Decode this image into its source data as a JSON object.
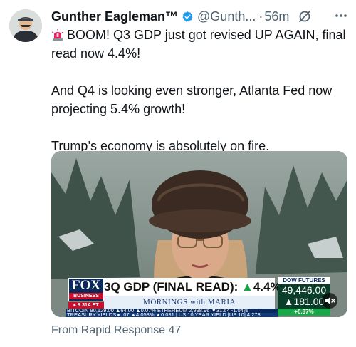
{
  "author": {
    "display_name": "Gunther Eagleman™",
    "handle": "@Gunth...",
    "time_separator": "·",
    "time": "56m",
    "avatar_icon": "profile-photo",
    "verified_icon": "verified-badge-icon"
  },
  "tweet": {
    "line1": "BOOM! Q3 GDP just got revised UP AGAIN, final read now 4.4%!",
    "line2": "And Q4 is looking even stronger, Atlanta Fed now projecting 5.4% growth!",
    "line3": "Trump’s economy is absolutely on fire.",
    "emoji_icon": "police-light-emoji"
  },
  "media": {
    "fox_logo": "FOX",
    "fox_sub": "BUSINESS",
    "time_tag": "▸ 8:31A ET",
    "headline_prefix": "3Q GDP (FINAL READ): ",
    "headline_arrow": "▲",
    "headline_value": "4.4%",
    "show_name": "MORNINGS with MARIA",
    "dow_title": "DOW FUTURES",
    "dow_value": "49,446.00",
    "dow_change": "▲181.00",
    "dow_pct": "+0.37%",
    "ticker_row1": "BITCOIN  90,129.00 ▲64.00 ▲0.07%  ETHEREUM  2,998.96 ▼31.64 -1.04%",
    "ticker_row2": "TREASURY YIELDS ▸ .07 ▲4.058% ▲0.031 | US 10 YEAR YIELD [US.10] 4.273",
    "mute_icon": "speaker-muted-icon"
  },
  "footer": {
    "source": "From Rapid Response 47"
  },
  "colors": {
    "text": "#0f1419",
    "secondary": "#536471",
    "verified": "#1d9bf0"
  }
}
